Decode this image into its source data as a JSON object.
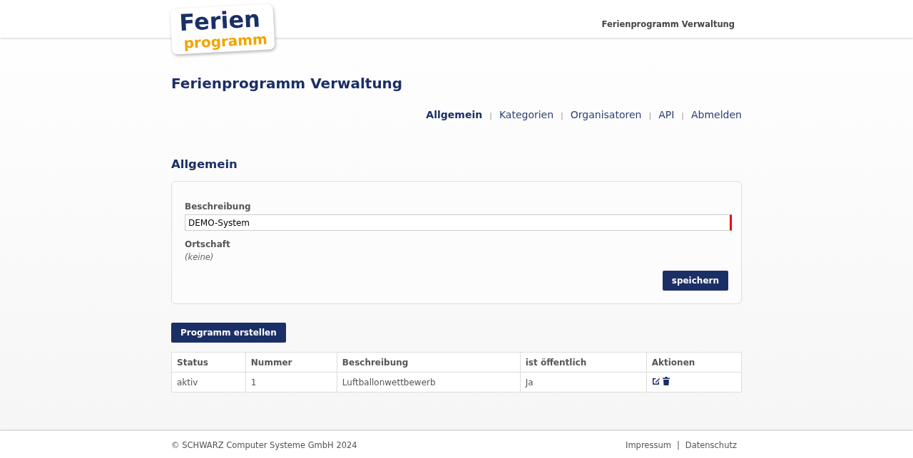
{
  "header": {
    "logo": {
      "line1": "Ferien",
      "line2": "programm"
    },
    "title": "Ferienprogramm Verwaltung"
  },
  "page_title": "Ferienprogramm Verwaltung",
  "nav": {
    "separator": "|",
    "items": [
      {
        "label": "Allgemein",
        "selected": true
      },
      {
        "label": "Kategorien",
        "selected": false
      },
      {
        "label": "Organisatoren",
        "selected": false
      },
      {
        "label": "API",
        "selected": false
      },
      {
        "label": "Abmelden",
        "selected": false
      }
    ]
  },
  "section_title": "Allgemein",
  "form": {
    "fields": [
      {
        "kind": "input",
        "label": "Beschreibung",
        "value": "DEMO-System",
        "required": true
      },
      {
        "kind": "readonly",
        "label": "Ortschaft",
        "value": "(keine)"
      }
    ],
    "save_button": "speichern"
  },
  "create_button": "Programm erstellen",
  "table": {
    "columns": [
      "Status",
      "Nummer",
      "Beschreibung",
      "ist öffentlich",
      "Aktionen"
    ],
    "rows": [
      {
        "cells": [
          "aktiv",
          "1",
          "Luftballonwettbewerb",
          "Ja"
        ]
      }
    ]
  },
  "footer": {
    "copyright": "© SCHWARZ Computer Systeme GmbH 2024",
    "separator": "|",
    "links": [
      "Impressum",
      "Datenschutz"
    ]
  }
}
